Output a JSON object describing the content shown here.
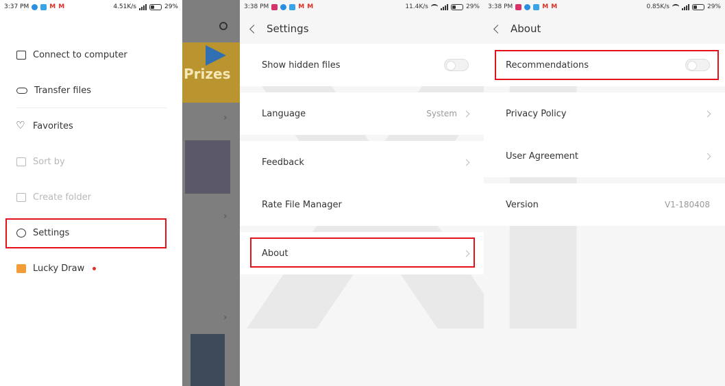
{
  "panel1": {
    "status": {
      "time": "3:37 PM",
      "speed": "4.51K/s",
      "battery": "29%"
    },
    "menu": [
      {
        "label": "Connect to computer",
        "icon": "monitor-icon",
        "enabled": true
      },
      {
        "label": "Transfer files",
        "icon": "link-icon",
        "enabled": true
      },
      {
        "label": "Favorites",
        "icon": "heart-icon",
        "enabled": true
      },
      {
        "label": "Sort by",
        "icon": "sort-icon",
        "enabled": false
      },
      {
        "label": "Create folder",
        "icon": "folder-icon",
        "enabled": false
      },
      {
        "label": "Settings",
        "icon": "gear-icon",
        "enabled": true,
        "highlighted": true
      },
      {
        "label": "Lucky Draw",
        "icon": "gift-icon",
        "enabled": true,
        "badge": "red-dot"
      }
    ],
    "background_banner": "Prizes"
  },
  "panel2": {
    "status": {
      "time": "3:38 PM",
      "speed": "11.4K/s",
      "battery": "29%"
    },
    "title": "Settings",
    "rows": {
      "show_hidden": {
        "label": "Show hidden files",
        "toggle": false
      },
      "language": {
        "label": "Language",
        "value": "System"
      },
      "feedback": {
        "label": "Feedback"
      },
      "rate": {
        "label": "Rate File Manager"
      },
      "about": {
        "label": "About",
        "highlighted": true
      }
    }
  },
  "panel3": {
    "status": {
      "time": "3:38 PM",
      "speed": "0.85K/s",
      "battery": "29%"
    },
    "title": "About",
    "rows": {
      "recommendations": {
        "label": "Recommendations",
        "toggle": false,
        "highlighted": true
      },
      "privacy": {
        "label": "Privacy Policy"
      },
      "agreement": {
        "label": "User Agreement"
      },
      "version": {
        "label": "Version",
        "value": "V1-180408"
      }
    }
  },
  "colors": {
    "highlight": "#e3121a",
    "background": "#f6f6f6",
    "badge": "#e0312b"
  }
}
